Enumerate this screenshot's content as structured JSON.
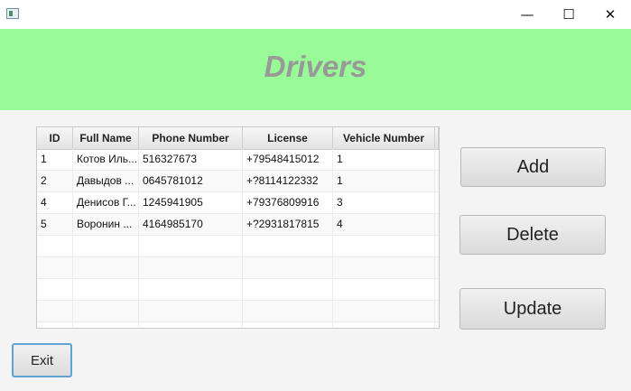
{
  "window": {
    "minimize_glyph": "—",
    "maximize_glyph": "☐",
    "close_glyph": "✕"
  },
  "header": {
    "title": "Drivers",
    "background": "#98fb98"
  },
  "table": {
    "columns": [
      "ID",
      "Full Name",
      "Phone Number",
      "License",
      "Vehicle Number"
    ],
    "rows": [
      [
        "1",
        "Котов Иль...",
        "516327673",
        "+79548415012",
        "1"
      ],
      [
        "2",
        "Давыдов ...",
        "0645781012",
        "+?8114122332",
        "1"
      ],
      [
        "4",
        "Денисов Г...",
        "1245941905",
        "+79376809916",
        "3"
      ],
      [
        "5",
        "Воронин ...",
        "4164985170",
        "+?2931817815",
        "4"
      ]
    ]
  },
  "actions": {
    "add": "Add",
    "delete": "Delete",
    "update": "Update",
    "exit": "Exit"
  }
}
